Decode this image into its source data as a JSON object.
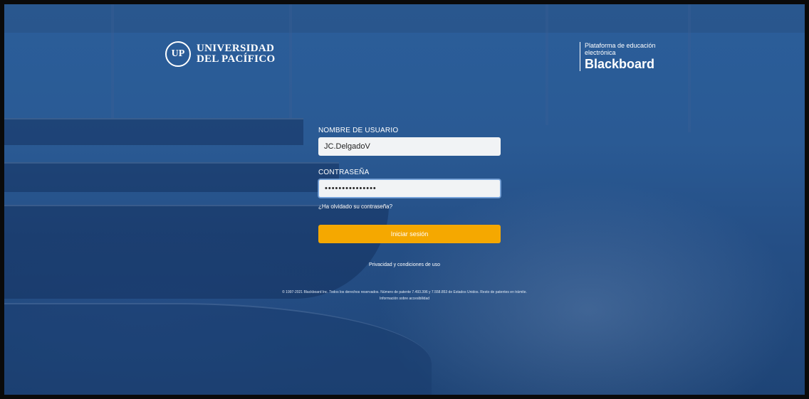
{
  "branding": {
    "university_seal_letter": "UP",
    "university_line1": "UNIVERSIDAD",
    "university_line2": "DEL PACÍFICO",
    "platform_line1": "Plataforma de educación",
    "platform_line2": "electrónica",
    "platform_name": "Blackboard"
  },
  "login": {
    "username_label": "NOMBRE DE USUARIO",
    "username_value": "JC.DelgadoV",
    "password_label": "CONTRASEÑA",
    "password_value": "•••••••••••••••",
    "forgot_link": "¿Ha olvidado su contraseña?",
    "submit_label": "Iniciar sesión"
  },
  "footer": {
    "privacy_link": "Privacidad y condiciones de uso",
    "copyright": "© 1997-2021 Blackboard Inc. Todos los derechos reservados. Número de patente 7.493.396 y 7.558.853 de Estados Unidos. Resto de patentes en trámite.",
    "accessibility_link": "Información sobre accesibilidad"
  },
  "colors": {
    "overlay_blue": "#2a5a94",
    "button_orange": "#f5a800"
  }
}
